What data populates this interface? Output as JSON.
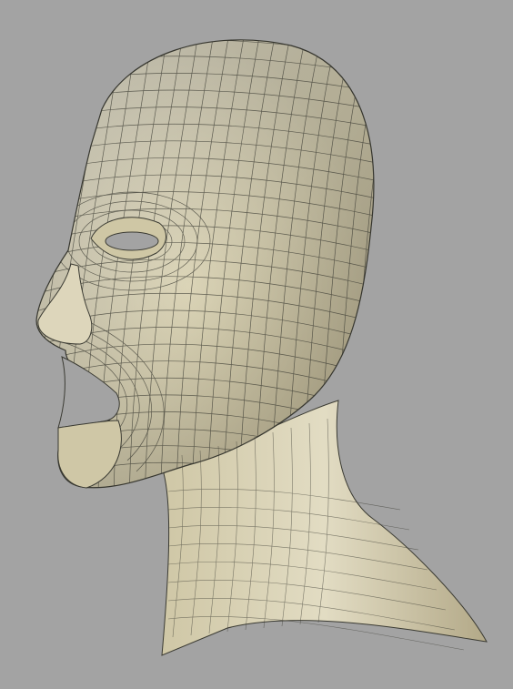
{
  "viewport": {
    "background": "#a3a3a3",
    "subject": "head-mesh"
  },
  "mesh": {
    "base_color": "#d9d2b4",
    "shade_color": "#b7ad8b",
    "highlight_color": "#ece8d6",
    "wire_color": "#3a3a32",
    "dark_color": "#4a4636"
  }
}
